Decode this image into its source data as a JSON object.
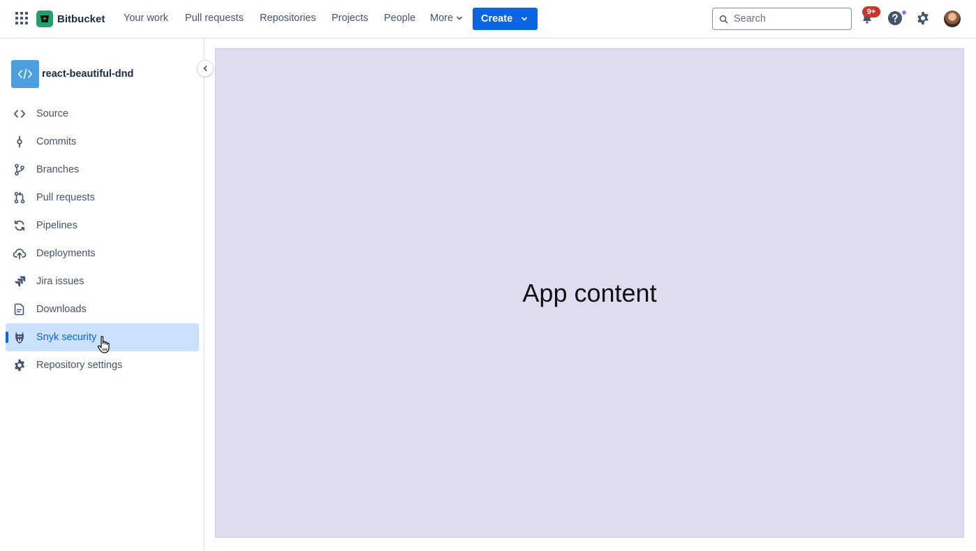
{
  "topnav": {
    "brand": "Bitbucket",
    "items": [
      {
        "label": "Your work"
      },
      {
        "label": "Pull requests"
      },
      {
        "label": "Repositories"
      },
      {
        "label": "Projects"
      },
      {
        "label": "People"
      },
      {
        "label": "More"
      }
    ],
    "create_label": "Create",
    "search_placeholder": "Search",
    "notifications_badge": "9+"
  },
  "sidebar": {
    "repo_name": "react-beautiful-dnd",
    "items": [
      {
        "label": "Source",
        "icon": "code-icon"
      },
      {
        "label": "Commits",
        "icon": "commit-icon"
      },
      {
        "label": "Branches",
        "icon": "branch-icon"
      },
      {
        "label": "Pull requests",
        "icon": "pull-request-icon"
      },
      {
        "label": "Pipelines",
        "icon": "pipelines-icon"
      },
      {
        "label": "Deployments",
        "icon": "cloud-upload-icon"
      },
      {
        "label": "Jira issues",
        "icon": "jira-icon"
      },
      {
        "label": "Downloads",
        "icon": "document-icon"
      },
      {
        "label": "Snyk security",
        "icon": "snyk-icon",
        "active": true
      },
      {
        "label": "Repository settings",
        "icon": "gear-icon"
      }
    ]
  },
  "main": {
    "placeholder_text": "App content"
  },
  "colors": {
    "accent": "#0c66e4",
    "brand": "#22a06b",
    "active_bg": "#cce0ff",
    "content_bg": "#dfdcf0",
    "badge": "#c9372c"
  }
}
